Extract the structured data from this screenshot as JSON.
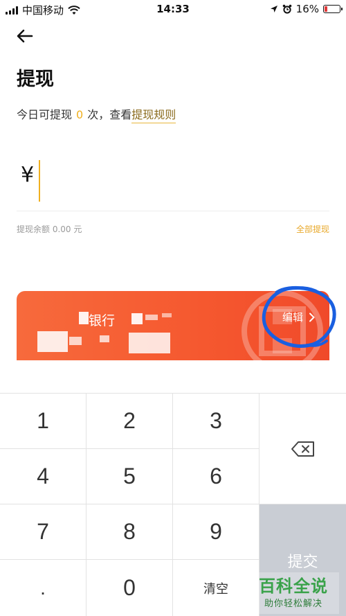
{
  "status_bar": {
    "carrier": "中国移动",
    "time": "14:33",
    "battery": "16%",
    "battery_level": 0.16
  },
  "page": {
    "title": "提现",
    "subtitle_prefix": "今日可提现",
    "count": "0",
    "subtitle_suffix": "次，查看",
    "rules_link": "提现规则"
  },
  "amount": {
    "currency": "¥",
    "value": ""
  },
  "balance": {
    "text": "提现余额 0.00 元",
    "withdraw_all": "全部提现"
  },
  "card": {
    "bank_name": "银行",
    "edit_label": "编辑"
  },
  "keypad": {
    "keys": [
      "1",
      "2",
      "3",
      "4",
      "5",
      "6",
      "7",
      "8",
      "9",
      ".",
      "0",
      "清空"
    ],
    "submit": "提交"
  },
  "watermark": {
    "title": "百科全说",
    "slogan": "助你轻松解决"
  },
  "colors": {
    "accent": "#f0b020",
    "card": "#f5582f",
    "submit": "#c9cdd4",
    "annotation": "#1a5fe0"
  }
}
